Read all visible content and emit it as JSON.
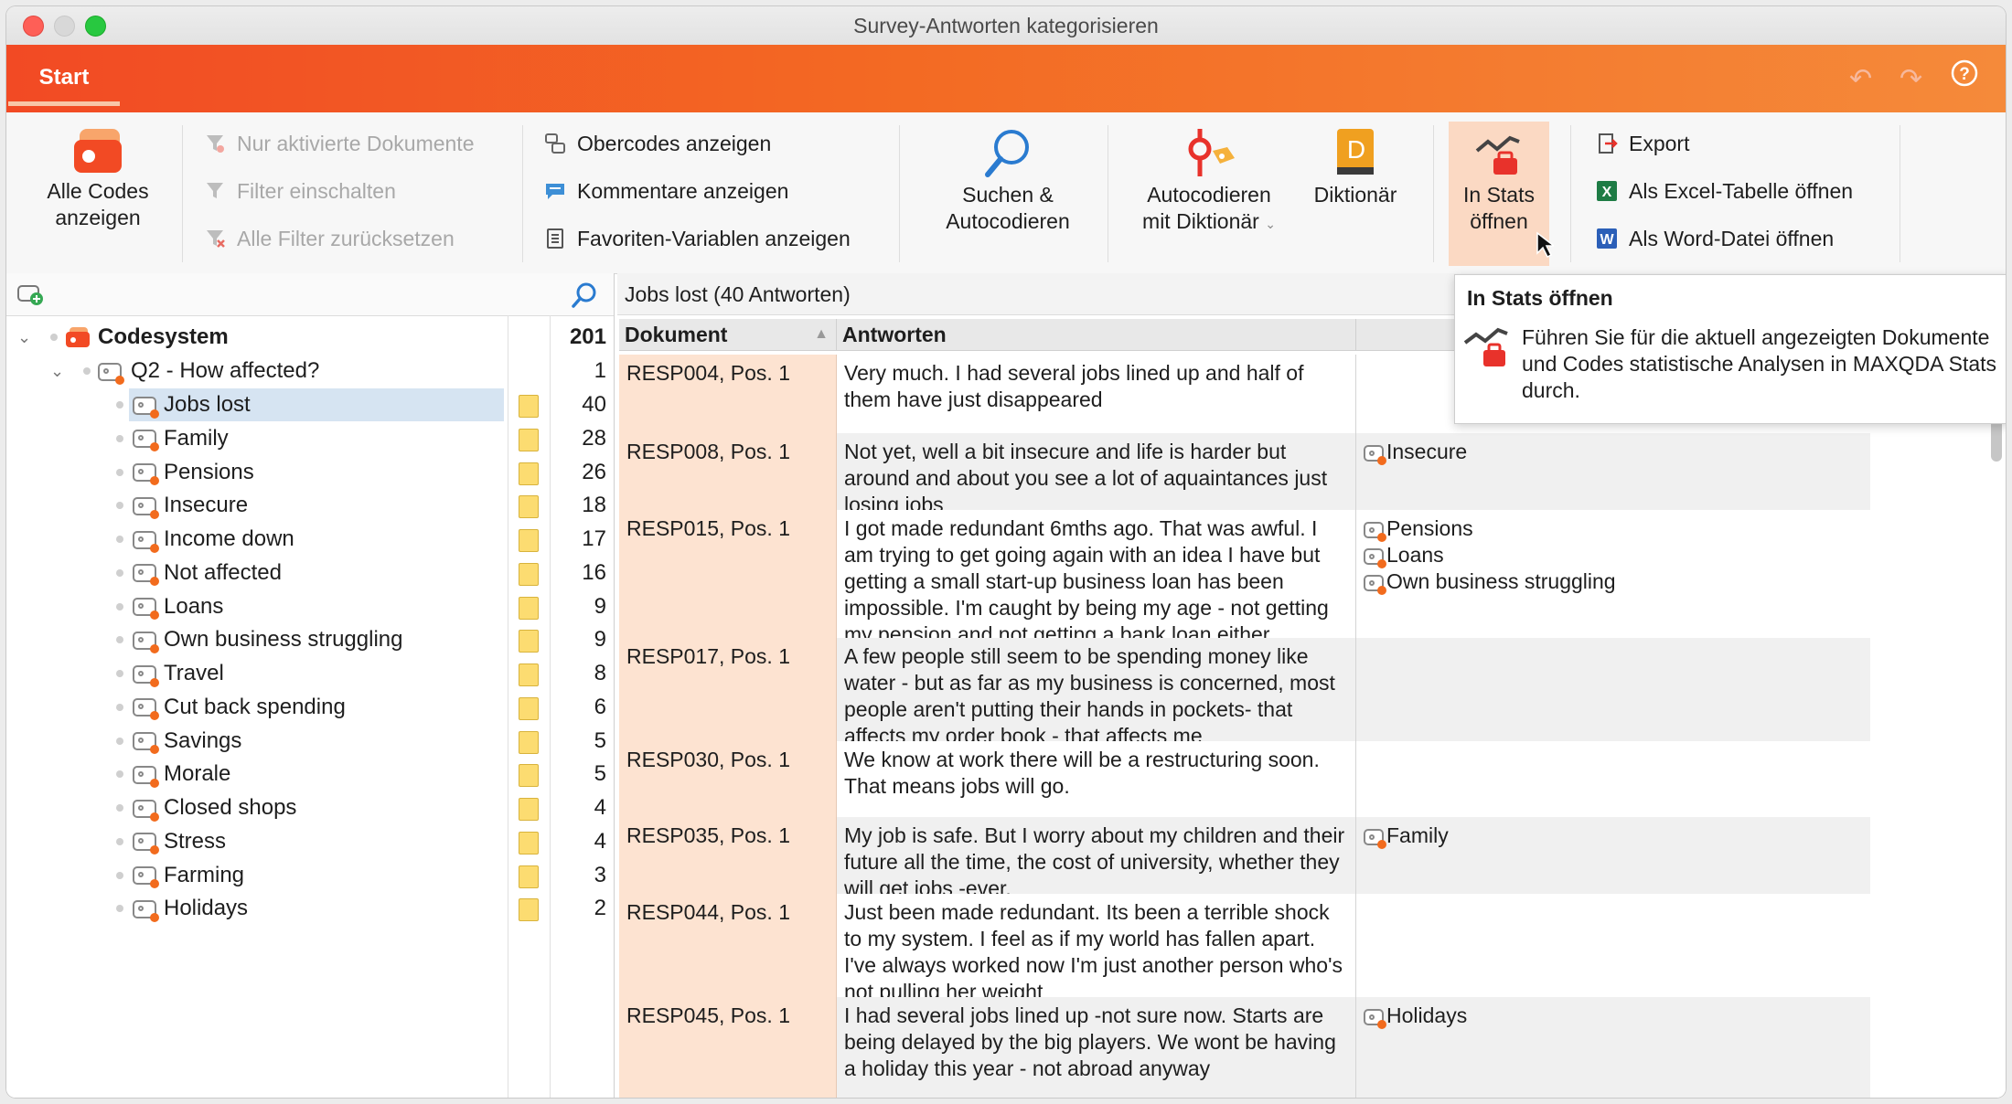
{
  "window": {
    "title": "Survey-Antworten kategorisieren"
  },
  "ribbon": {
    "tab": "Start",
    "all_codes": "Alle Codes anzeigen",
    "only_active": "Nur aktivierte Dokumente",
    "filter_on": "Filter einschalten",
    "reset_filters": "Alle Filter zurücksetzen",
    "show_parent_codes": "Obercodes anzeigen",
    "show_comments": "Kommentare anzeigen",
    "show_fav_vars": "Favoriten-Variablen anzeigen",
    "search_line1": "Suchen &",
    "search_line2": "Autocodieren",
    "autocode_line1": "Autocodieren",
    "autocode_line2": "mit Diktionär",
    "dictionary": "Diktionär",
    "stats_line1": "In Stats",
    "stats_line2": "öffnen",
    "export": "Export",
    "excel": "Als Excel-Tabelle öffnen",
    "word": "Als Word-Datei öffnen"
  },
  "tree": {
    "root": {
      "label": "Codesystem",
      "count": "201"
    },
    "parent": {
      "label": "Q2 - How affected?",
      "count": "1"
    },
    "items": [
      {
        "label": "Jobs lost",
        "count": "40"
      },
      {
        "label": "Family",
        "count": "28"
      },
      {
        "label": "Pensions",
        "count": "26"
      },
      {
        "label": "Insecure",
        "count": "18"
      },
      {
        "label": "Income down",
        "count": "17"
      },
      {
        "label": "Not affected",
        "count": "16"
      },
      {
        "label": "Loans",
        "count": "9"
      },
      {
        "label": "Own business struggling",
        "count": "9"
      },
      {
        "label": "Travel",
        "count": "8"
      },
      {
        "label": "Cut back spending",
        "count": "6"
      },
      {
        "label": "Savings",
        "count": "5"
      },
      {
        "label": "Morale",
        "count": "5"
      },
      {
        "label": "Closed shops",
        "count": "4"
      },
      {
        "label": "Stress",
        "count": "4"
      },
      {
        "label": "Farming",
        "count": "3"
      },
      {
        "label": "Holidays",
        "count": "2"
      }
    ]
  },
  "table": {
    "title": "Jobs lost (40 Antworten)",
    "col_doc": "Dokument",
    "col_answers": "Antworten",
    "rows": [
      {
        "doc": "RESP004, Pos. 1",
        "text": "Very much. I had several jobs lined up and half of them have just disappeared",
        "codes": []
      },
      {
        "doc": "RESP008, Pos. 1",
        "text": "Not yet, well a bit insecure and life is harder but around and about you see a lot of aquaintances just losing jobs",
        "codes": [
          "Insecure"
        ]
      },
      {
        "doc": "RESP015, Pos. 1",
        "text": "I got made redundant 6mths ago. That was awful. I am trying to get going again with an idea I have but getting a small start-up business loan has been impossible. I'm caught by being my age - not getting my pension and not getting a bank loan either.",
        "codes": [
          "Pensions",
          "Loans",
          "Own business struggling"
        ]
      },
      {
        "doc": "RESP017, Pos. 1",
        "text": "A few people still seem to be spending money like water - but as far as my business is concerned, most people aren't putting their hands in pockets- that affects my order book - that affects me",
        "codes": []
      },
      {
        "doc": "RESP030, Pos. 1",
        "text": "We know at work there will be a restructuring soon. That means jobs will go.",
        "codes": []
      },
      {
        "doc": "RESP035, Pos. 1",
        "text": "My job is safe. But I worry about my children and their future all the time, the cost of university, whether they will get jobs -ever.",
        "codes": [
          "Family"
        ]
      },
      {
        "doc": "RESP044, Pos. 1",
        "text": "Just been made redundant. Its been a terrible shock to my system. I feel as if my world has fallen apart. I've always worked now I'm just another person who's not pulling her weight",
        "codes": []
      },
      {
        "doc": "RESP045, Pos. 1",
        "text": "I had several jobs lined up -not sure now. Starts are being delayed by the big players. We wont be having a holiday this year - not abroad anyway",
        "codes": [
          "Holidays"
        ]
      }
    ]
  },
  "tooltip": {
    "title": "In Stats öffnen",
    "body": "Führen Sie für die aktuell angezeigten Dokumente und Codes statistische Analysen in MAXQDA Stats durch."
  }
}
